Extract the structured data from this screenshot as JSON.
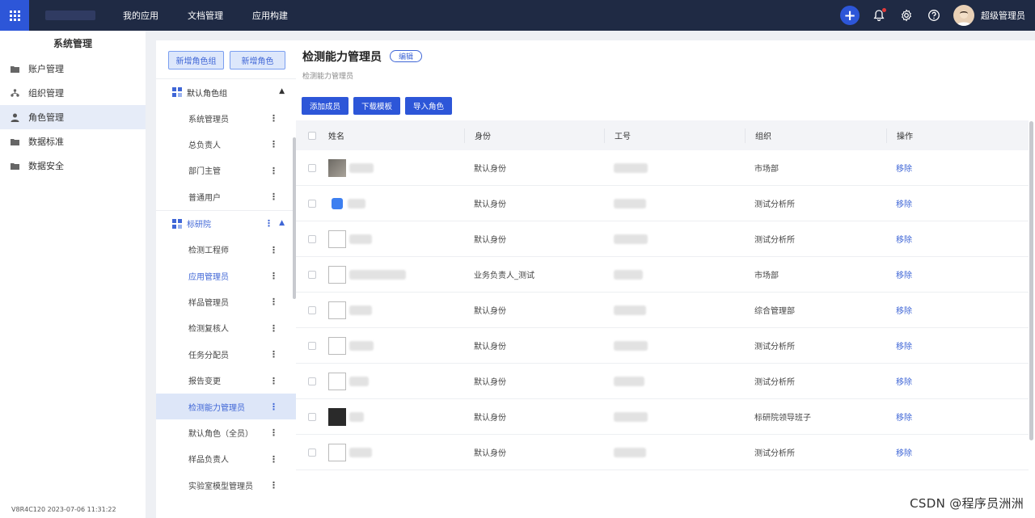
{
  "topbar": {
    "nav": [
      "我的应用",
      "文档管理",
      "应用构建"
    ],
    "user_name": "超级管理员",
    "icons": [
      "apps-grid-icon",
      "plus-icon",
      "bell-icon",
      "gear-icon",
      "help-icon"
    ]
  },
  "sidebar": {
    "title": "系统管理",
    "items": [
      {
        "label": "账户管理",
        "icon": "folder-icon"
      },
      {
        "label": "组织管理",
        "icon": "org-icon"
      },
      {
        "label": "角色管理",
        "icon": "user-icon"
      },
      {
        "label": "数据标准",
        "icon": "folder-icon"
      },
      {
        "label": "数据安全",
        "icon": "folder-icon"
      }
    ],
    "version": "V8R4C120 2023-07-06 11:31:22"
  },
  "rolepanel": {
    "buttons": [
      "新增角色组",
      "新增角色"
    ],
    "groups": [
      {
        "label": "默认角色组",
        "roles": [
          "系统管理员",
          "总负责人",
          "部门主管",
          "普通用户"
        ]
      },
      {
        "label": "标研院",
        "roles": [
          "检测工程师",
          "应用管理员",
          "样品管理员",
          "检测复核人",
          "任务分配员",
          "报告变更",
          "检测能力管理员",
          "默认角色（全员）",
          "样品负责人",
          "实验室模型管理员"
        ]
      }
    ]
  },
  "main": {
    "title": "检测能力管理员",
    "edit_label": "编辑",
    "subtitle": "检测能力管理员",
    "actions": [
      "添加成员",
      "下载模板",
      "导入角色"
    ],
    "columns": [
      "姓名",
      "身份",
      "工号",
      "组织",
      "操作"
    ],
    "rows": [
      {
        "role": "默认身份",
        "org": "市场部",
        "op": "移除"
      },
      {
        "role": "默认身份",
        "org": "测试分析所",
        "op": "移除"
      },
      {
        "role": "默认身份",
        "org": "测试分析所",
        "op": "移除"
      },
      {
        "role": "业务负责人_测试",
        "org": "市场部",
        "op": "移除"
      },
      {
        "role": "默认身份",
        "org": "综合管理部",
        "op": "移除"
      },
      {
        "role": "默认身份",
        "org": "测试分析所",
        "op": "移除"
      },
      {
        "role": "默认身份",
        "org": "测试分析所",
        "op": "移除"
      },
      {
        "role": "默认身份",
        "org": "标研院领导班子",
        "op": "移除"
      },
      {
        "role": "默认身份",
        "org": "测试分析所",
        "op": "移除"
      }
    ]
  },
  "watermark": "CSDN @程序员洲洲"
}
